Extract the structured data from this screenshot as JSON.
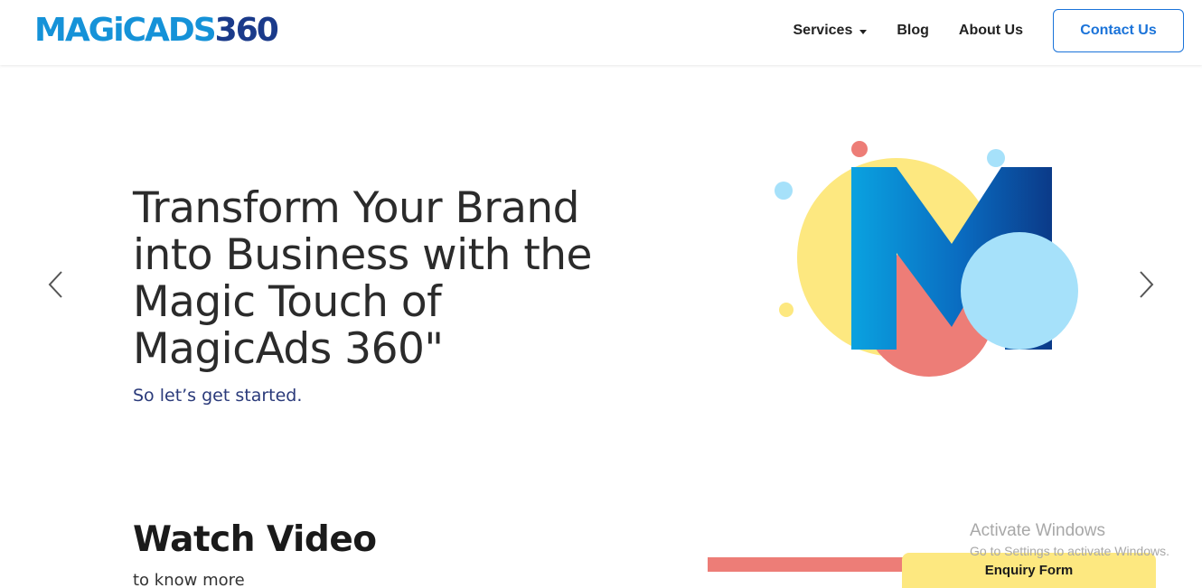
{
  "header": {
    "logo_text_a": "MAGiCADS",
    "logo_text_b": "360",
    "nav": {
      "services": "Services",
      "blog": "Blog",
      "about": "About Us",
      "contact": "Contact Us"
    }
  },
  "hero": {
    "title_lines": [
      "Transform Your Brand",
      "into Business with the",
      "Magic Touch of",
      "MagicAds 360\""
    ],
    "subtitle": "So let’s get started.",
    "prev_icon": "chevron-left-icon",
    "next_icon": "chevron-right-icon"
  },
  "video": {
    "title": "Watch Video",
    "subtitle": "to know more"
  },
  "enquiry": {
    "label": "Enquiry Form"
  },
  "watermark": {
    "line1": "Activate Windows",
    "line2": "Go to Settings to activate Windows."
  },
  "colors": {
    "brand_blue": "#1592d8",
    "brand_navy": "#1a3a8a",
    "link_blue": "#1a73d9",
    "yellow": "#fde880",
    "coral": "#ed7d77",
    "light_blue": "#a6e1fa"
  }
}
